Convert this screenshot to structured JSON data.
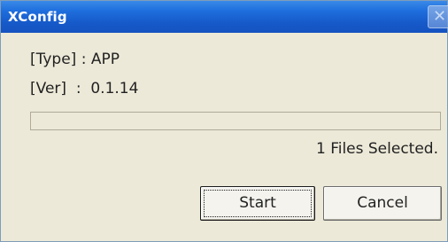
{
  "window": {
    "title": "XConfig",
    "close_glyph": "✕"
  },
  "info": {
    "type_line": "[Type] : APP",
    "ver_line": "[Ver]  :  0.1.14"
  },
  "progress": {
    "value_percent": 0
  },
  "status": {
    "text": "1 Files Selected."
  },
  "buttons": {
    "start_label": "Start",
    "cancel_label": "Cancel"
  },
  "colors": {
    "titlebar_blue": "#1659c9",
    "dialog_background": "#ece9d8"
  }
}
